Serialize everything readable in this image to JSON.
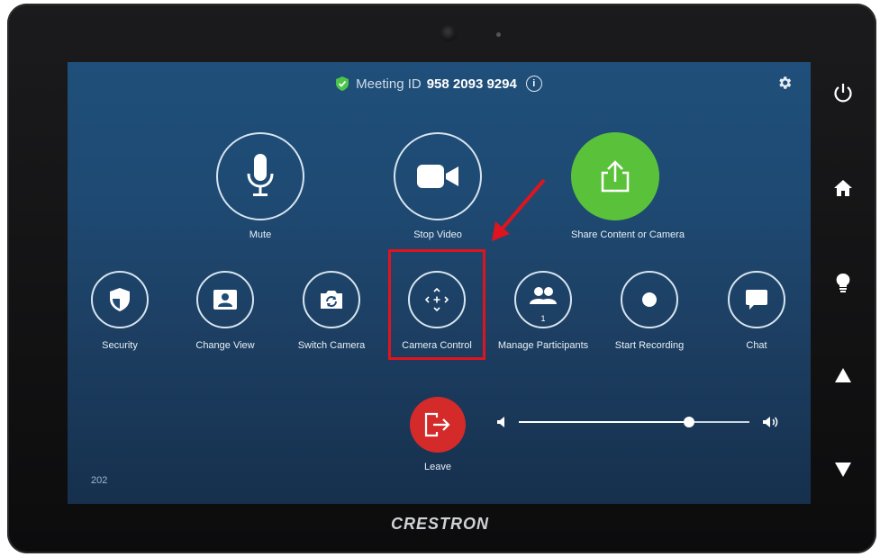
{
  "device": {
    "brand": "CRESTRON"
  },
  "header": {
    "meeting_id_label": "Meeting ID",
    "meeting_id": "958 2093 9294",
    "shield_color": "#4cc44a"
  },
  "main_actions": [
    {
      "label": "Mute",
      "icon": "microphone-icon"
    },
    {
      "label": "Stop Video",
      "icon": "video-camera-icon"
    },
    {
      "label": "Share Content or Camera",
      "icon": "share-icon",
      "accent": "#5ac23a"
    }
  ],
  "secondary_actions": [
    {
      "label": "Security",
      "icon": "shield-icon"
    },
    {
      "label": "Change View",
      "icon": "change-view-icon"
    },
    {
      "label": "Switch Camera",
      "icon": "switch-camera-icon"
    },
    {
      "label": "Camera Control",
      "icon": "camera-control-icon"
    },
    {
      "label": "Manage Participants",
      "icon": "participants-icon",
      "badge": "1"
    },
    {
      "label": "Start Recording",
      "icon": "record-icon"
    },
    {
      "label": "Chat",
      "icon": "chat-icon"
    }
  ],
  "leave": {
    "label": "Leave",
    "color": "#d42a2a"
  },
  "room_number": "202",
  "volume": {
    "level": 0.74
  },
  "hardware_buttons": [
    "power-icon",
    "home-icon",
    "lightbulb-icon",
    "arrow-up-icon",
    "arrow-down-icon"
  ],
  "annotation": {
    "highlight_color": "#e0141e"
  }
}
